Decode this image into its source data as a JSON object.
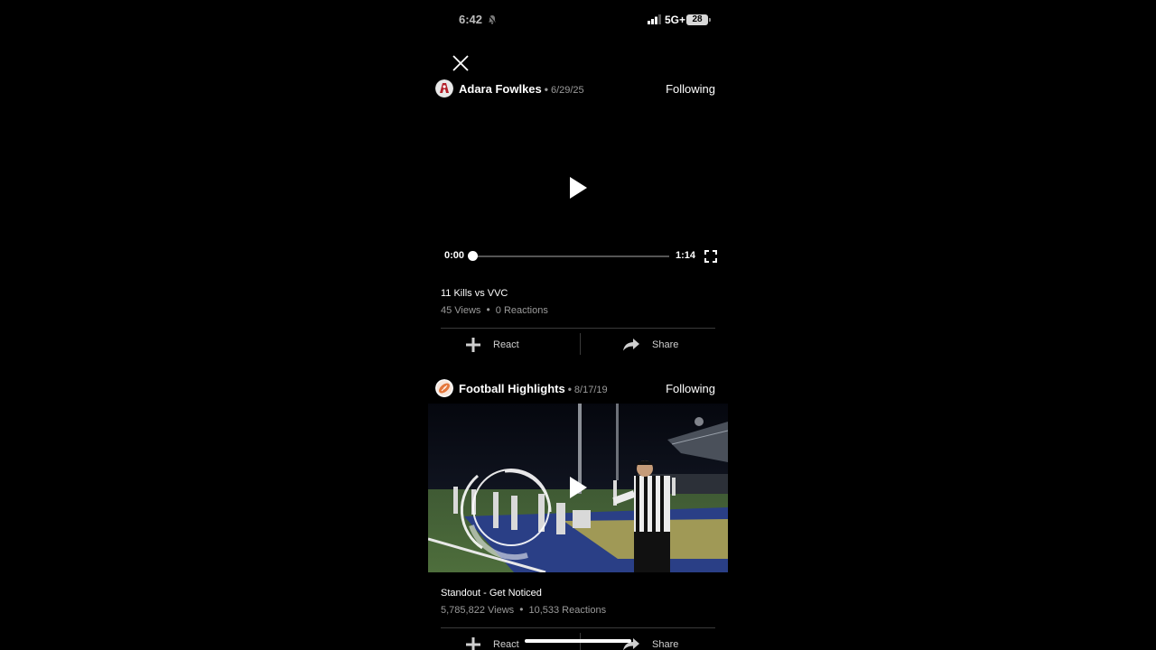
{
  "status_bar": {
    "time": "6:42",
    "network": "5G+",
    "battery": "28"
  },
  "posts": [
    {
      "author": "Adara Fowlkes",
      "separator": "•",
      "date": "6/29/25",
      "follow_label": "Following",
      "video": {
        "current_time": "0:00",
        "duration": "1:14",
        "progress": 0.0
      },
      "title": "11 Kills vs VVC",
      "views": "45 Views",
      "reactions": "0 Reactions",
      "react_label": "React",
      "share_label": "Share"
    },
    {
      "author": "Football Highlights",
      "separator": "•",
      "date": "8/17/19",
      "follow_label": "Following",
      "title": "Standout - Get Noticed",
      "views": "5,785,822 Views",
      "reactions": "10,533 Reactions",
      "react_label": "React",
      "share_label": "Share"
    }
  ],
  "stats_separator": "•",
  "icons": [
    "bell-icon",
    "signal-icon",
    "battery-icon",
    "close-icon",
    "play-icon",
    "fullscreen-icon",
    "plus-icon",
    "share-arrow-icon",
    "football-icon",
    "avatar-logo"
  ],
  "colors": {
    "background": "#000000",
    "text": "#ffffff",
    "muted": "#9a9a9a",
    "divider": "#3a3a3a"
  }
}
